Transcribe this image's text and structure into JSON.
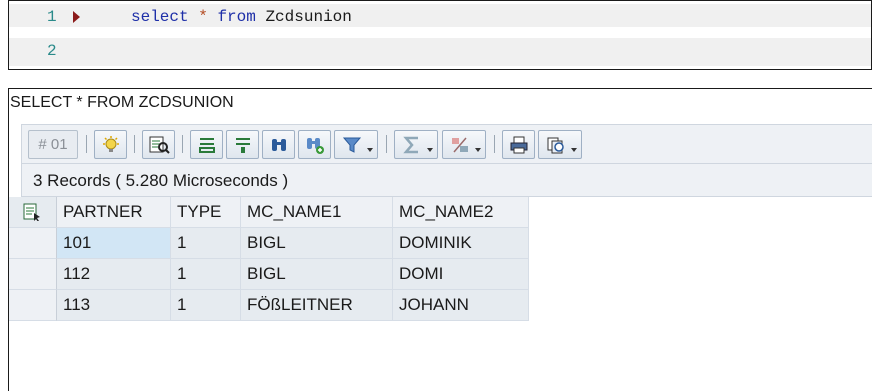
{
  "editor": {
    "lines": [
      {
        "number": "1",
        "code_keyword1": "select",
        "code_op": "*",
        "code_keyword2": "from",
        "code_ident": "Zcdsunion"
      },
      {
        "number": "2"
      }
    ]
  },
  "result": {
    "title": "SELECT * FROM ZCDSUNION",
    "toolbar": {
      "count_button": "# 01",
      "icons": [
        "bulb-icon",
        "details-icon",
        "align-top-icon",
        "filter-lines-icon",
        "find-icon",
        "find-next-icon",
        "filter-icon",
        "sum-icon",
        "subtotal-icon",
        "print-icon",
        "export-icon"
      ]
    },
    "status": "3 Records ( 5.280 Microseconds )",
    "columns": [
      "PARTNER",
      "TYPE",
      "MC_NAME1",
      "MC_NAME2"
    ],
    "rows": [
      [
        "101",
        "1",
        "BIGL",
        "DOMINIK"
      ],
      [
        "112",
        "1",
        "BIGL",
        "DOMI"
      ],
      [
        "113",
        "1",
        "FÖßLEITNER",
        "JOHANN"
      ]
    ]
  },
  "colors": {
    "keyword": "#1e2fa8",
    "operator": "#b2481f",
    "line_number": "#2a8a8a",
    "selected_cell": "#d2e6f5",
    "grid_cell": "#e6ebf0"
  }
}
